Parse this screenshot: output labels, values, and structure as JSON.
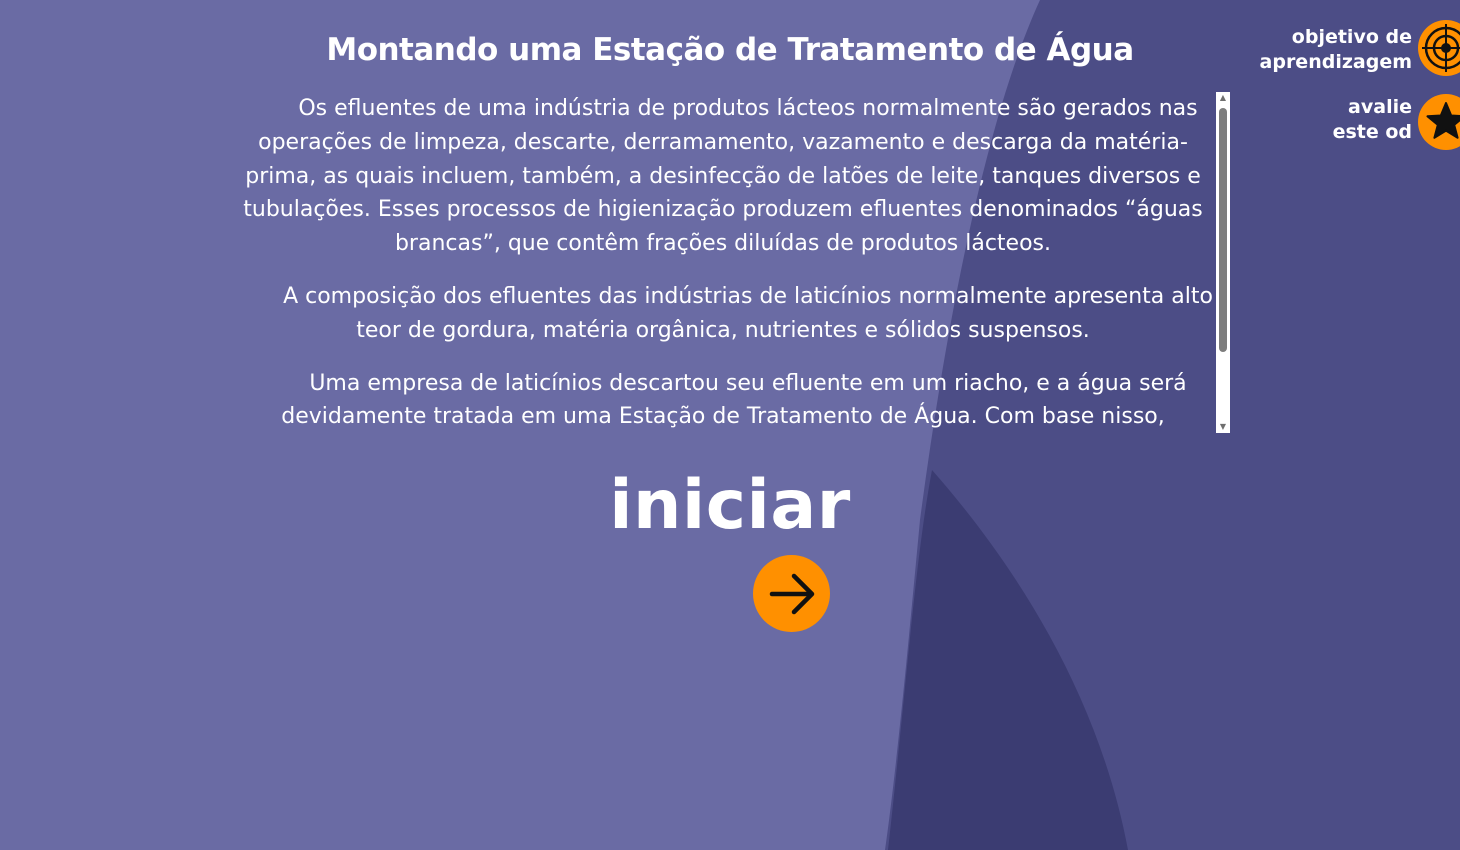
{
  "page": {
    "title": "Montando uma Estação de Tratamento de Água",
    "intro_paragraphs": [
      "Os efluentes de uma indústria de produtos lácteos normalmente são gerados nas operações de limpeza, descarte, derramamento, vazamento e descarga da matéria-prima, as quais incluem, também, a desinfecção de latões de leite, tanques diversos e tubulações. Esses processos de higienização produzem efluentes denominados “águas brancas”, que contêm frações diluídas de produtos lácteos.",
      "A composição dos efluentes das indústrias de laticínios normalmente apresenta alto teor de gordura, matéria orgânica, nutrientes e sólidos suspensos.",
      "Uma empresa de laticínios descartou seu efluente em um riacho, e a água será devidamente tratada em uma Estação de Tratamento de Água. Com base nisso,"
    ],
    "start_label": "iniciar"
  },
  "top_links": {
    "objective_line1": "objetivo de",
    "objective_line2": "aprendizagem",
    "rate_line1": "avalie",
    "rate_line2": "este od"
  },
  "icons": {
    "objective": "target-icon",
    "rate": "star-icon",
    "start": "arrow-right-icon"
  },
  "colors": {
    "background": "#6a6ba4",
    "accent": "#ff9000",
    "shape_dark": "#4c4d86",
    "shape_darker": "#3b3c72"
  }
}
